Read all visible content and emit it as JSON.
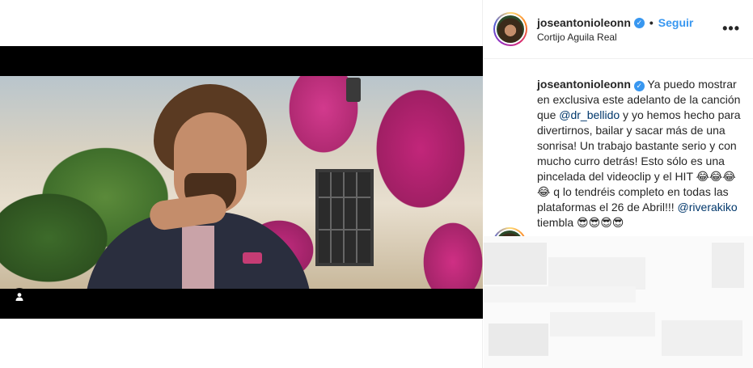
{
  "post": {
    "username": "joseantonioleonn",
    "follow_label": "Seguir",
    "separator": "•",
    "location": "Cortijo Aguila Real",
    "more_label": "•••",
    "verified_glyph": "✓"
  },
  "caption": {
    "username": "joseantonioleonn",
    "text_1": "Ya puedo mostrar en exclusiva este adelanto de la canción que ",
    "mention_1": "@dr_bellido",
    "text_2": " y yo hemos hecho para divertirnos, bailar y sacar más de una sonrisa! Un trabajo bastante serio y con mucho curro detrás! Esto sólo es una pincelada del videoclip y el HIT 😂😂😂😂 q lo tendréis completo en todas las plataformas el 26 de Abril!!! ",
    "mention_2": "@riverakiko",
    "text_3": " tiembla 😎😎😎😎"
  },
  "icons": {
    "user_tag": "user-tag-icon",
    "verified": "verified-badge-icon",
    "more": "more-options-icon"
  },
  "colors": {
    "link_blue": "#3897f0",
    "mention_blue": "#00376b",
    "text": "#262626",
    "border": "#efefef"
  }
}
